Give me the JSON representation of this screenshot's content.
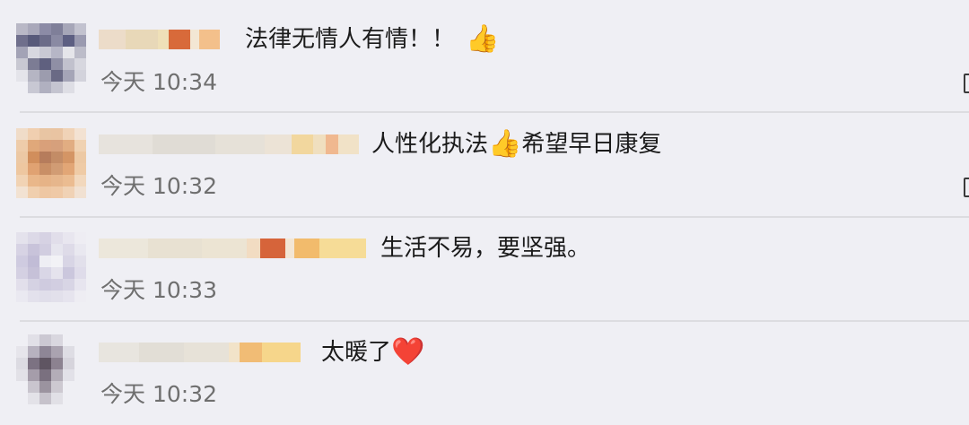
{
  "comments": [
    {
      "text_before": "法律无情人有情！！",
      "emoji": "👍",
      "text_after": "",
      "time": "今天 10:34",
      "has_right_icon": true
    },
    {
      "text_before": "人性化执法",
      "emoji": "👍",
      "text_after": "希望早日康复",
      "time": "今天 10:32",
      "has_right_icon": true
    },
    {
      "text_before": "生活不易，要坚强。",
      "emoji": "",
      "text_after": "",
      "time": "今天 10:33",
      "has_right_icon": false
    },
    {
      "text_before": "太暖了",
      "emoji": "❤️",
      "text_after": "",
      "time": "今天 10:32",
      "has_right_icon": false
    }
  ]
}
